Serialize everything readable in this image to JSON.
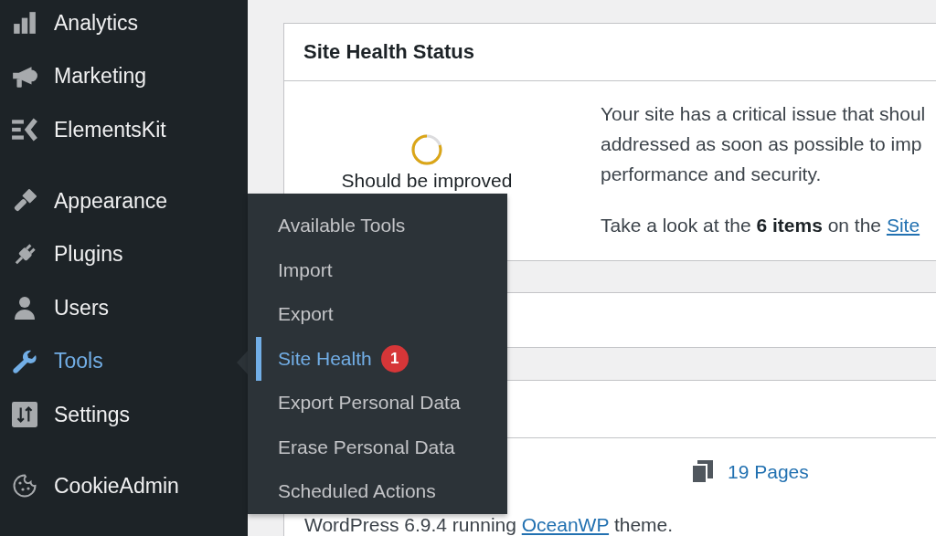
{
  "sidebar": {
    "sections": [
      {
        "items": [
          {
            "label": "Analytics",
            "selected": false
          },
          {
            "label": "Marketing",
            "selected": false
          },
          {
            "label": "ElementsKit",
            "selected": false
          }
        ]
      },
      {
        "items": [
          {
            "label": "Appearance",
            "selected": false
          },
          {
            "label": "Plugins",
            "selected": false
          },
          {
            "label": "Users",
            "selected": false
          },
          {
            "label": "Tools",
            "selected": true
          },
          {
            "label": "Settings",
            "selected": false
          }
        ]
      },
      {
        "items": [
          {
            "label": "CookieAdmin",
            "selected": false
          }
        ]
      }
    ]
  },
  "flyout": {
    "items": [
      {
        "label": "Available Tools",
        "selected": false
      },
      {
        "label": "Import",
        "selected": false
      },
      {
        "label": "Export",
        "selected": false
      },
      {
        "label": "Site Health",
        "selected": true,
        "badge": "1"
      },
      {
        "label": "Export Personal Data",
        "selected": false
      },
      {
        "label": "Erase Personal Data",
        "selected": false
      },
      {
        "label": "Scheduled Actions",
        "selected": false
      }
    ]
  },
  "site_health": {
    "title": "Site Health Status",
    "status": {
      "label": "Should be improved"
    },
    "description_lines": [
      "Your site has a critical issue that shoul",
      "addressed as soon as possible to imp",
      "performance and security."
    ],
    "action_text": "Take a look at the **6 items** on the",
    "action_link": "Site"
  },
  "at_a_glance": {
    "items": [
      {
        "label": "19 Pages"
      }
    ],
    "version_before": "WordPress 6.9.4 running",
    "theme_link": "OceanWP",
    "version_after": "theme."
  }
}
